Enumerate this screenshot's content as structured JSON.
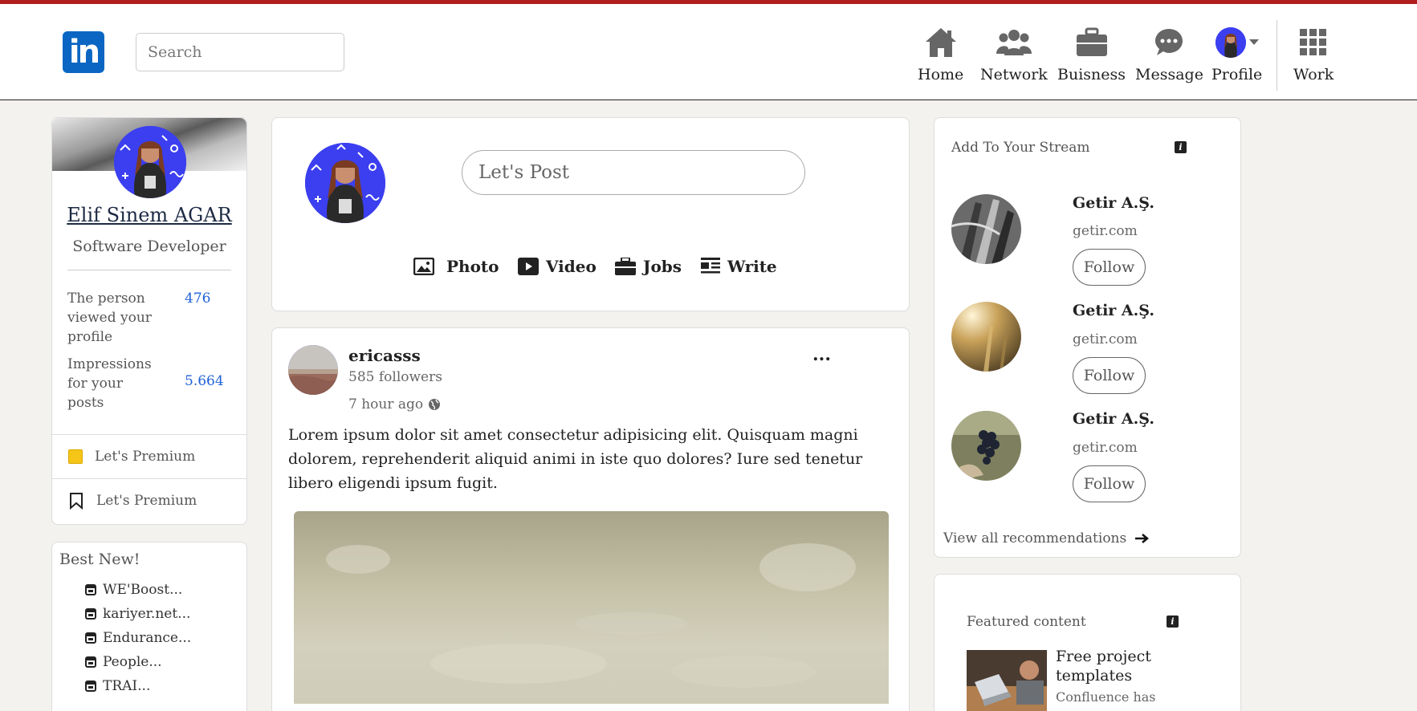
{
  "header": {
    "logo_text": "in",
    "search_placeholder": "Search",
    "nav": [
      {
        "label": "Home",
        "icon": "home-icon"
      },
      {
        "label": "Network",
        "icon": "network-icon"
      },
      {
        "label": "Buisness",
        "icon": "briefcase-icon"
      },
      {
        "label": "Message",
        "icon": "message-icon"
      },
      {
        "label": "Profile",
        "icon": "avatar"
      },
      {
        "label": "Work",
        "icon": "grid-icon"
      }
    ],
    "accent_color": "#b21e1e",
    "brand_color": "#0a66c2"
  },
  "profile": {
    "name": "Elif Sinem AGAR",
    "title": "Software Developer",
    "stats": [
      {
        "label": "The person viewed your profile",
        "value": "476"
      },
      {
        "label": "Impressions for your posts",
        "value": "5.664"
      }
    ],
    "premium_links": [
      {
        "label": "Let's Premium",
        "icon": "premium-square-icon"
      },
      {
        "label": "Let's Premium",
        "icon": "bookmark-icon"
      }
    ]
  },
  "best_new": {
    "title": "Best New!",
    "items": [
      "WE'Boost...",
      "kariyer.net...",
      "Endurance...",
      "People...",
      "TRAI..."
    ]
  },
  "composer": {
    "placeholder": "Let's Post",
    "actions": [
      {
        "label": "Photo",
        "icon": "photo-icon"
      },
      {
        "label": "Video",
        "icon": "video-icon"
      },
      {
        "label": "Jobs",
        "icon": "briefcase-icon"
      },
      {
        "label": "Write",
        "icon": "article-icon"
      }
    ]
  },
  "post": {
    "author": "ericasss",
    "followers": "585 followers",
    "time": "7 hour ago",
    "more": "...",
    "body": "Lorem ipsum dolor sit amet consectetur adipisicing elit. Quisquam magni dolorem, reprehenderit aliquid animi in iste quo dolores? Iure sed tenetur libero eligendi ipsum fugit."
  },
  "stream": {
    "title": "Add To Your Stream",
    "recommendations": [
      {
        "name": "Getir A.Ş.",
        "site": "getir.com",
        "button": "Follow"
      },
      {
        "name": "Getir A.Ş.",
        "site": "getir.com",
        "button": "Follow"
      },
      {
        "name": "Getir A.Ş.",
        "site": "getir.com",
        "button": "Follow"
      }
    ],
    "view_all": "View all recommendations"
  },
  "featured": {
    "title": "Featured content",
    "headline": "Free project templates",
    "subtitle": "Confluence has"
  }
}
